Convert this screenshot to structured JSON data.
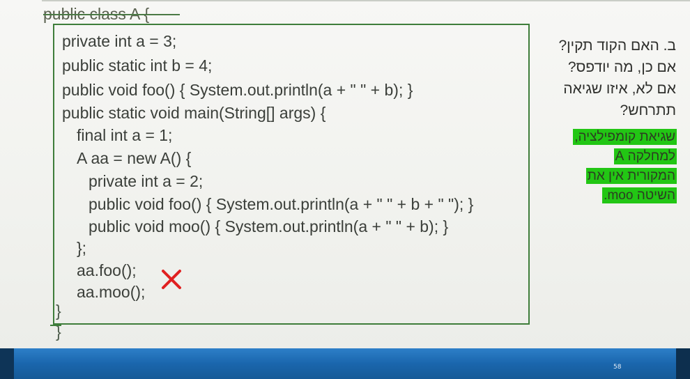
{
  "code": {
    "header": "public class A {",
    "lines": [
      "private int a = 3;",
      "public static int b = 4;",
      "public void foo() { System.out.println(a + \" \" + b); }",
      "public static void main(String[] args) {",
      "final int a = 1;",
      "A aa = new A() {",
      "private int a = 2;",
      "public void foo() { System.out.println(a + \" \" + b + \" \"); }",
      "public void moo() { System.out.println(a + \" \" + b); }",
      "};",
      "aa.foo();",
      "aa.moo();"
    ],
    "close_method": "}",
    "close_class": "}"
  },
  "question": {
    "line1": "ב. האם הקוד תקין?",
    "line2": "אם כן, מה יודפס?",
    "line3": "אם לא, איזו שגיאה",
    "line4": "תתרחש?"
  },
  "answer": {
    "line1": "שגיאת קומפילציה,",
    "line2": "למחלקה A",
    "line3": "המקורית אין את",
    "line4": "השיטה moo."
  },
  "footer": {
    "page_number": "58"
  },
  "colors": {
    "code_frame": "#3e7d3a",
    "highlight": "#22c614",
    "error_mark": "#e02020",
    "footer": "#1a66ad"
  },
  "icons": {
    "error_mark": "red-x-icon"
  }
}
